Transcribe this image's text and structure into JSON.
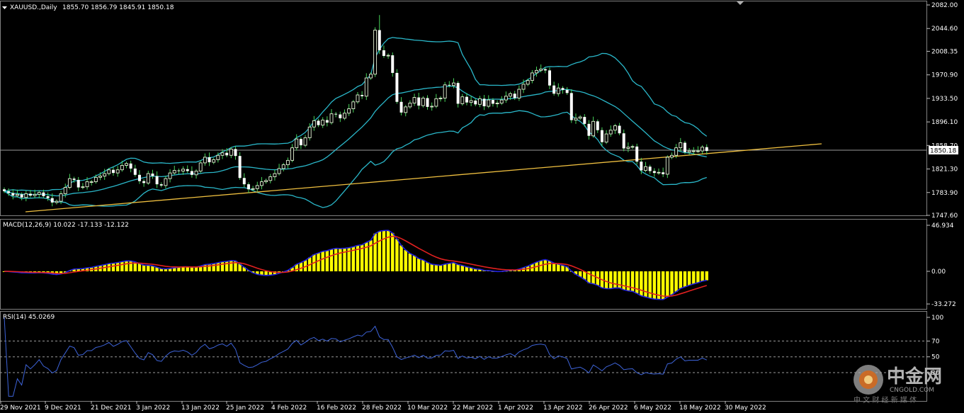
{
  "header": {
    "symbol": "XAUUSD.,Daily",
    "ohlc": "1855.70 1856.79 1845.91 1850.18",
    "macd_label": "MACD(12,26,9) 10.022 -17.133 -12.122",
    "rsi_label": "RSI(14) 45.0269"
  },
  "watermark": {
    "brand": "中金网",
    "domain": "CNGOLD.COM",
    "tagline": "中 文 财 经 新 媒 体"
  },
  "colors": {
    "background": "#000000",
    "bull_candle": "#e8f5d8",
    "bear_candle": "#ffffff",
    "wick": "#47d45a",
    "bollinger": "#2ab7c9",
    "trendline": "#f0c040",
    "macd_hist": "#ffff00",
    "macd_line": "#2020e0",
    "signal_line": "#e02020",
    "rsi_line": "#3d63d8",
    "grid": "#808080"
  },
  "chart_data": [
    {
      "type": "candlestick",
      "name": "price",
      "y_ticks": [
        "2082.00",
        "2044.60",
        "2008.35",
        "1970.90",
        "1933.50",
        "1896.10",
        "1858.70",
        "1821.30",
        "1783.90",
        "1747.60"
      ],
      "y_tick_values": [
        2082.0,
        2044.6,
        2008.35,
        1970.9,
        1933.5,
        1896.1,
        1858.7,
        1821.3,
        1783.9,
        1747.6
      ],
      "ylim": [
        1742,
        2082
      ],
      "current_price": "1850.18",
      "x_labels": [
        "29 Nov 2021",
        "9 Dec 2021",
        "21 Dec 2021",
        "3 Jan 2022",
        "13 Jan 2022",
        "25 Jan 2022",
        "4 Feb 2022",
        "16 Feb 2022",
        "28 Feb 2022",
        "10 Mar 2022",
        "22 Mar 2022",
        "1 Apr 2022",
        "13 Apr 2022",
        "26 Apr 2022",
        "6 May 2022",
        "18 May 2022",
        "30 May 2022"
      ],
      "close": [
        1786,
        1783,
        1779,
        1781,
        1776,
        1782,
        1779,
        1781,
        1784,
        1778,
        1775,
        1768,
        1770,
        1782,
        1792,
        1806,
        1804,
        1792,
        1793,
        1801,
        1801,
        1808,
        1810,
        1814,
        1820,
        1815,
        1820,
        1827,
        1830,
        1822,
        1812,
        1802,
        1799,
        1814,
        1810,
        1797,
        1795,
        1806,
        1815,
        1819,
        1818,
        1821,
        1818,
        1812,
        1818,
        1831,
        1840,
        1832,
        1836,
        1843,
        1847,
        1843,
        1853,
        1842,
        1807,
        1797,
        1789,
        1790,
        1795,
        1801,
        1803,
        1809,
        1814,
        1822,
        1828,
        1835,
        1855,
        1869,
        1859,
        1871,
        1888,
        1898,
        1891,
        1899,
        1895,
        1909,
        1908,
        1902,
        1910,
        1917,
        1928,
        1939,
        1937,
        1966,
        1972,
        2042,
        2010,
        2001,
        2002,
        1974,
        1928,
        1911,
        1920,
        1926,
        1935,
        1922,
        1934,
        1920,
        1921,
        1933,
        1934,
        1955,
        1954,
        1958,
        1925,
        1936,
        1927,
        1930,
        1924,
        1933,
        1921,
        1931,
        1925,
        1926,
        1931,
        1937,
        1941,
        1934,
        1948,
        1956,
        1962,
        1974,
        1978,
        1980,
        1978,
        1954,
        1941,
        1950,
        1947,
        1942,
        1899,
        1902,
        1904,
        1893,
        1874,
        1897,
        1883,
        1864,
        1877,
        1883,
        1890,
        1878,
        1854,
        1856,
        1857,
        1833,
        1819,
        1825,
        1818,
        1815,
        1816,
        1813,
        1840,
        1843,
        1855,
        1863,
        1848,
        1850,
        1850,
        1850,
        1856,
        1850
      ]
    },
    {
      "type": "bar+line",
      "name": "MACD(12,26,9)",
      "values": {
        "main": 10.022,
        "signal": -17.133,
        "histogram": -12.122
      },
      "y_ticks": [
        "46.934",
        "0.00",
        "-33.272"
      ],
      "ylim": [
        -36,
        48
      ]
    },
    {
      "type": "line",
      "name": "RSI(14)",
      "value": 45.0269,
      "y_ticks": [
        "100",
        "70",
        "50",
        "30"
      ],
      "levels": [
        70,
        50,
        30
      ],
      "ylim": [
        0,
        100
      ]
    }
  ]
}
